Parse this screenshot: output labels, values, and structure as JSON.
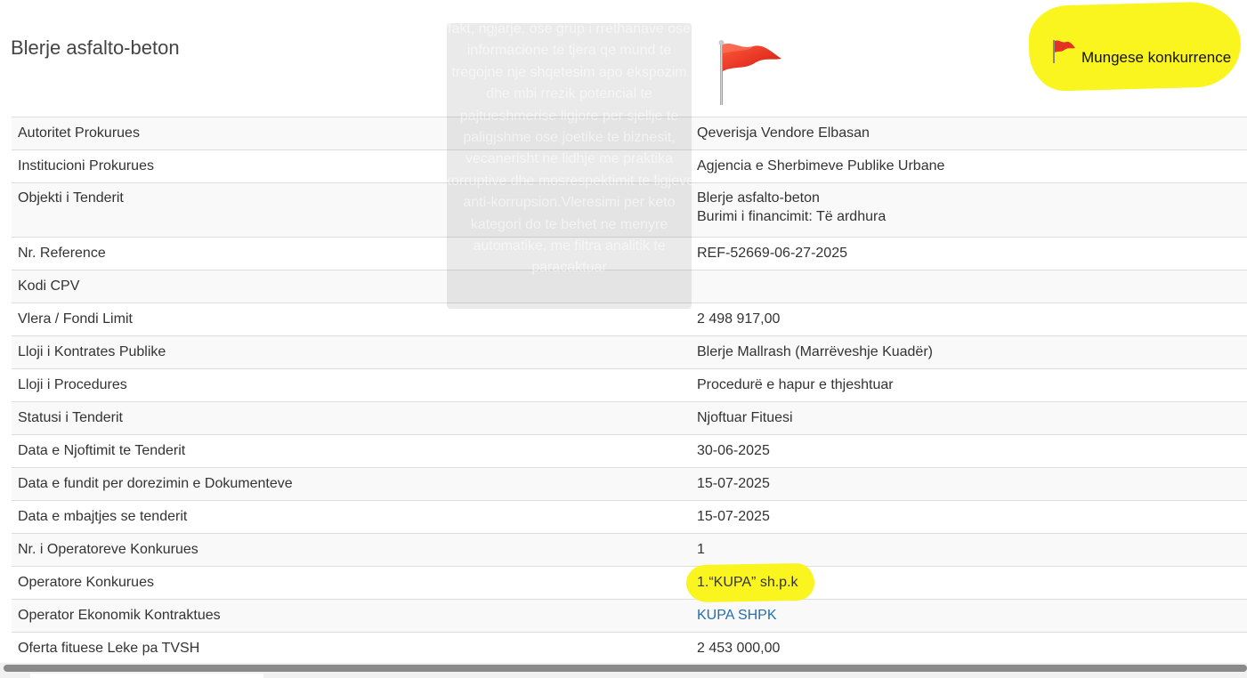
{
  "page": {
    "title": "Blerje asfalto-beton"
  },
  "flag": {
    "label": "Mungese konkurrence",
    "flag_color": "#e53322",
    "highlight_color": "#fbf51f"
  },
  "tooltip": {
    "text": "fakt, ngjarje, ose grup i rrethanave ose informacione te tjera qe mund te tregojne nje shqetesim apo ekspozim dhe mbi rrezik potencial te pajtueshmerise ligjore per sjellje te paligjshme ose joetike te biznesit, vecanerisht ne lidhje me praktika korruptive dhe mosrespektimit te ligjeve anti-korrupsion.Vleresimi per keto kategori do te behet ne menyre automatike, me filtra analitik te paracaktuar"
  },
  "details": {
    "rows": [
      {
        "label": "Autoritet Prokurues",
        "value": "Qeverisja Vendore Elbasan"
      },
      {
        "label": "Institucioni Prokurues",
        "value": "Agjencia e Sherbimeve Publike Urbane"
      },
      {
        "label": "Objekti i Tenderit",
        "value": "Blerje asfalto-beton",
        "value2": "Burimi i financimit: Të ardhura"
      },
      {
        "label": "Nr. Reference",
        "value": "REF-52669-06-27-2025"
      },
      {
        "label": "Kodi CPV",
        "value": ""
      },
      {
        "label": "Vlera / Fondi Limit",
        "value": "2 498 917,00"
      },
      {
        "label": "Lloji i Kontrates Publike",
        "value": "Blerje Mallrash (Marrëveshje Kuadër)"
      },
      {
        "label": "Lloji i Procedures",
        "value": "Procedurë e hapur e thjeshtuar"
      },
      {
        "label": "Statusi i Tenderit",
        "value": "Njoftuar Fituesi"
      },
      {
        "label": "Data e Njoftimit te Tenderit",
        "value": "30-06-2025"
      },
      {
        "label": "Data e fundit per dorezimin e Dokumenteve",
        "value": "15-07-2025"
      },
      {
        "label": "Data e mbajtjes se tenderit",
        "value": "15-07-2025"
      },
      {
        "label": "Nr. i Operatoreve Konkurues",
        "value": "1"
      },
      {
        "label": "Operatore Konkurues",
        "value": "1.“KUPA” sh.p.k"
      },
      {
        "label": "Operator Ekonomik Kontraktues",
        "value": "KUPA SHPK"
      },
      {
        "label": "Oferta fituese Leke pa TVSH",
        "value": "2 453 000,00"
      }
    ]
  }
}
